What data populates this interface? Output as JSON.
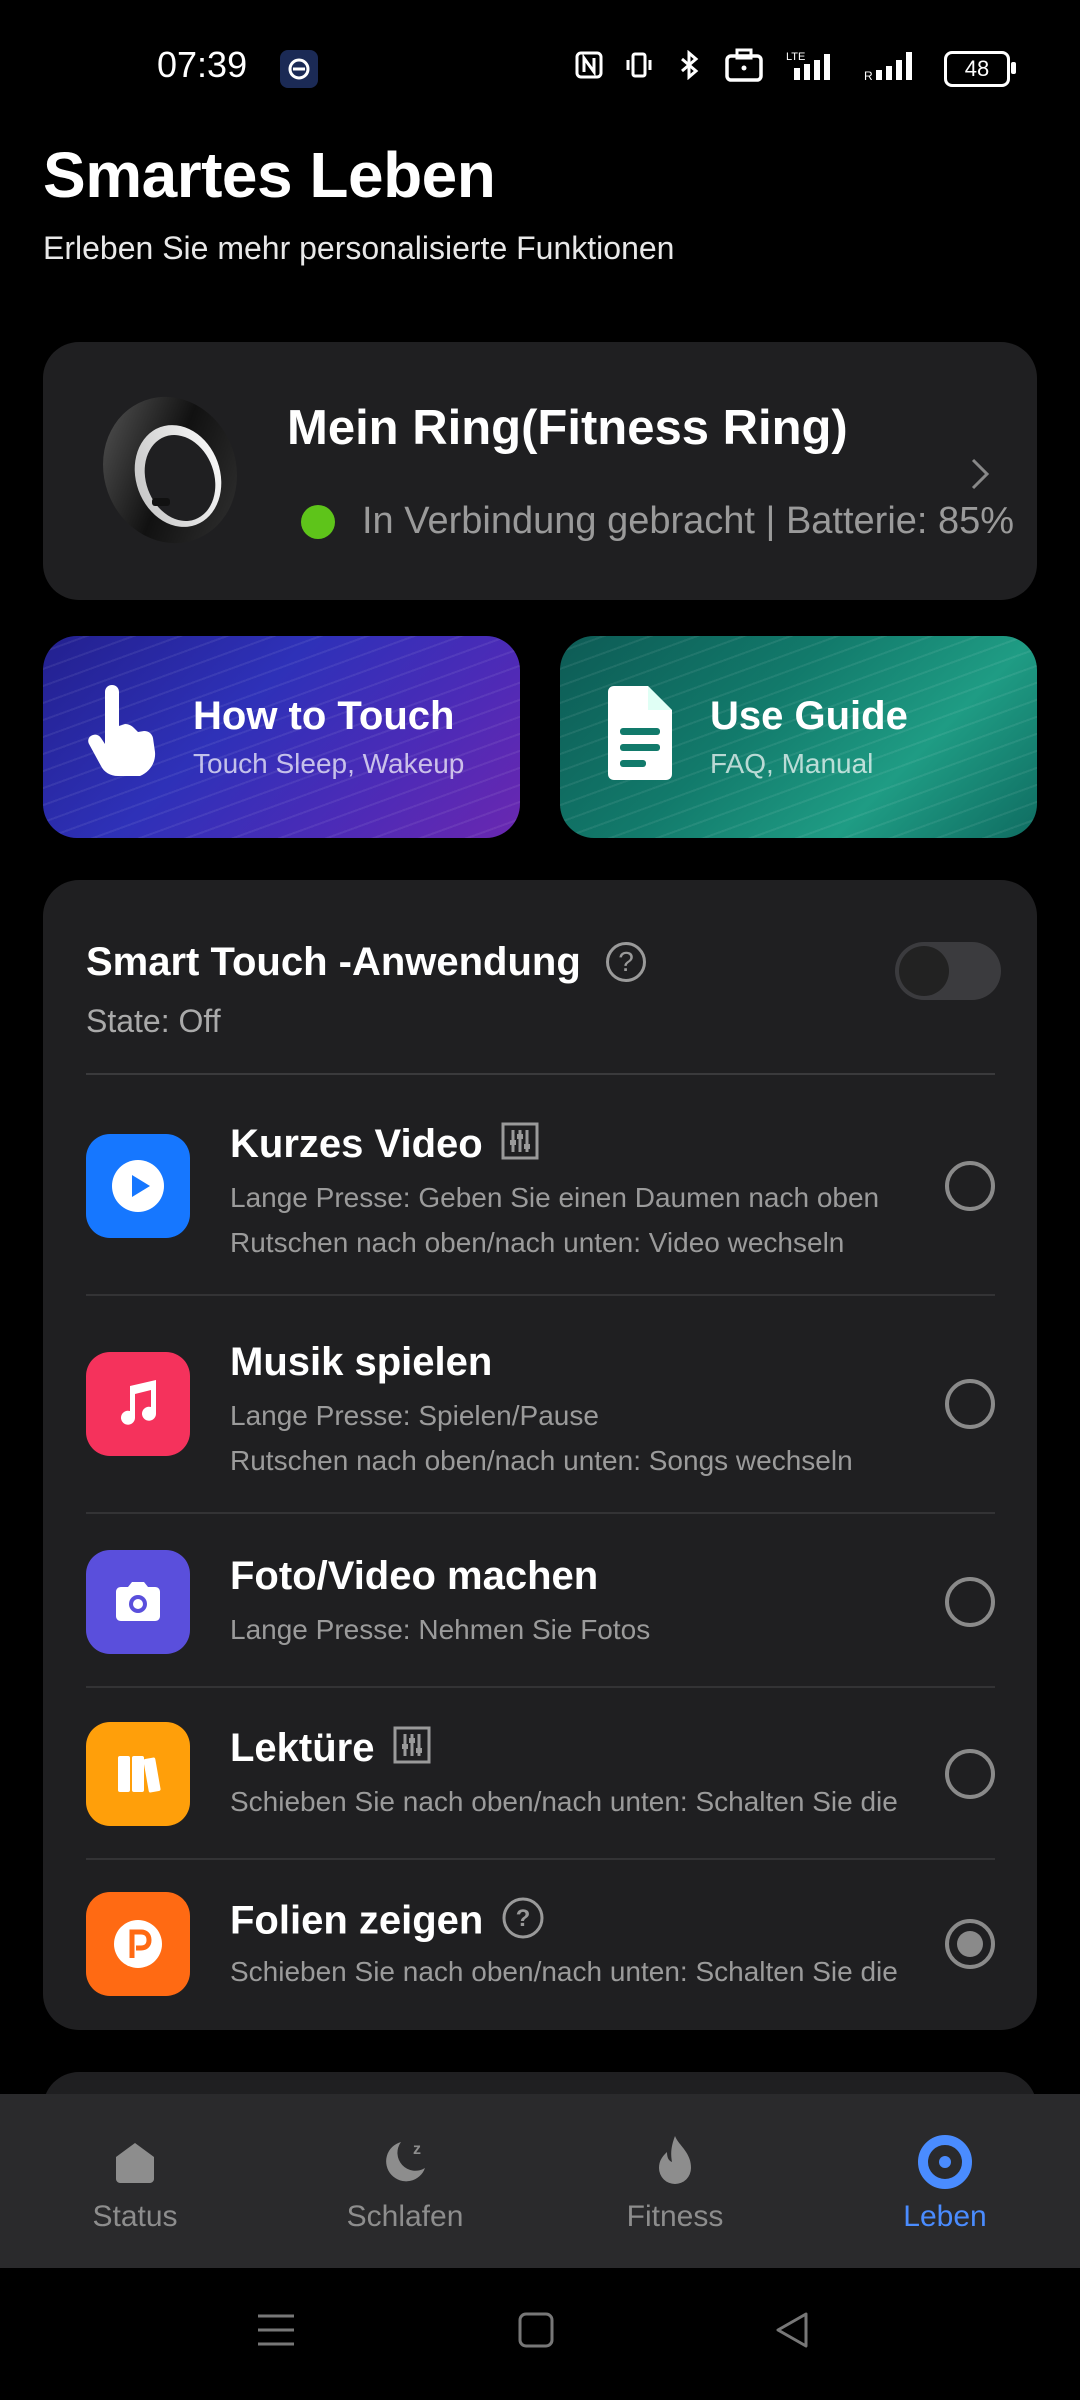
{
  "status_bar": {
    "time": "07:39",
    "battery": "48"
  },
  "header": {
    "title": "Smartes Leben",
    "subtitle": "Erleben Sie mehr personalisierte Funktionen"
  },
  "device": {
    "name": "Mein Ring(Fitness Ring)",
    "status": "In Verbindung gebracht | Batterie: 85%",
    "status_color": "#5ec41a"
  },
  "tiles": [
    {
      "title": "How to Touch",
      "subtitle": "Touch Sleep, Wakeup"
    },
    {
      "title": "Use Guide",
      "subtitle": "FAQ, Manual"
    }
  ],
  "smart_touch": {
    "title": "Smart Touch -Anwendung",
    "state": "State: Off",
    "enabled": false,
    "apps": [
      {
        "title": "Kurzes Video",
        "lines": [
          "Lange Presse: Geben Sie einen Daumen nach oben",
          "Rutschen nach oben/nach unten: Video wechseln"
        ],
        "icon": "play-icon",
        "color": "#1677ff",
        "selected": false
      },
      {
        "title": "Musik spielen",
        "lines": [
          "Lange Presse: Spielen/Pause",
          "Rutschen nach oben/nach unten: Songs wechseln"
        ],
        "icon": "music-note-icon",
        "color": "#f5325c",
        "selected": false
      },
      {
        "title": "Foto/Video machen",
        "lines": [
          "Lange Presse: Nehmen Sie Fotos"
        ],
        "icon": "camera-icon",
        "color": "#5a4fdc",
        "selected": false
      },
      {
        "title": "Lektüre",
        "lines": [
          "Schieben Sie nach oben/nach unten: Schalten Sie die"
        ],
        "icon": "book-icon",
        "color": "#ff9f0a",
        "selected": false
      },
      {
        "title": "Folien zeigen",
        "lines": [
          "Schieben Sie nach oben/nach unten: Schalten Sie die"
        ],
        "icon": "presentation-icon",
        "color": "#ff6a13",
        "selected": true
      }
    ]
  },
  "bottom_nav": [
    {
      "label": "Status",
      "icon": "home-icon",
      "active": false
    },
    {
      "label": "Schlafen",
      "icon": "moon-sleep-icon",
      "active": false
    },
    {
      "label": "Fitness",
      "icon": "flame-icon",
      "active": false
    },
    {
      "label": "Leben",
      "icon": "life-icon",
      "active": true
    }
  ],
  "accent_color": "#4a8cff"
}
